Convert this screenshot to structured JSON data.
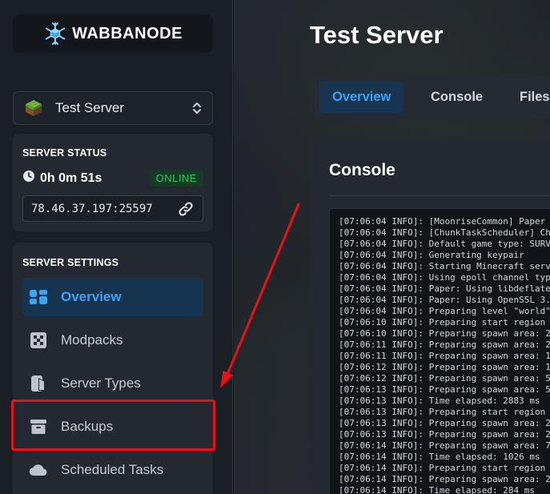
{
  "brand": {
    "name": "WABBANODE",
    "icon": "snowflake-cube-icon"
  },
  "server_select": {
    "label": "Test Server",
    "icon": "grass-block-icon",
    "chevron": "chevron-updown-icon"
  },
  "server_status": {
    "title": "SERVER STATUS",
    "uptime": "0h 0m 51s",
    "state": "ONLINE",
    "address": "78.46.37.197:25597"
  },
  "server_settings": {
    "title": "SERVER SETTINGS",
    "items": [
      {
        "label": "Overview",
        "icon": "overview-icon",
        "active": true
      },
      {
        "label": "Modpacks",
        "icon": "modpacks-icon",
        "active": false
      },
      {
        "label": "Server Types",
        "icon": "server-types-icon",
        "active": false
      },
      {
        "label": "Backups",
        "icon": "backups-icon",
        "active": false
      },
      {
        "label": "Scheduled Tasks",
        "icon": "cloud-icon",
        "active": false
      }
    ]
  },
  "main": {
    "title": "Test Server",
    "tabs": [
      {
        "label": "Overview",
        "active": true
      },
      {
        "label": "Console",
        "active": false
      },
      {
        "label": "Files",
        "active": false
      }
    ],
    "console_title": "Console",
    "console_lines": [
      "[07:06:04 INFO]: [MoonriseCommon] Paper",
      "[07:06:04 INFO]: [ChunkTaskScheduler] Ch",
      "[07:06:04 INFO]: Default game type: SURV",
      "[07:06:04 INFO]: Generating keypair",
      "[07:06:04 INFO]: Starting Minecraft serv",
      "[07:06:04 INFO]: Using epoll channel typ",
      "[07:06:04 INFO]: Paper: Using libdeflate",
      "[07:06:04 INFO]: Paper: Using OpenSSL 3.",
      "[07:06:04 INFO]: Preparing level \"world\"",
      "[07:06:10 INFO]: Preparing start region",
      "[07:06:10 INFO]: Preparing spawn area: 2",
      "[07:06:11 INFO]: Preparing spawn area: 2",
      "[07:06:11 INFO]: Preparing spawn area: 1",
      "[07:06:12 INFO]: Preparing spawn area: 1",
      "[07:06:12 INFO]: Preparing spawn area: 5",
      "[07:06:13 INFO]: Preparing spawn area: 5",
      "[07:06:13 INFO]: Time elapsed: 2883 ms",
      "[07:06:13 INFO]: Preparing start region",
      "[07:06:13 INFO]: Preparing spawn area: 2",
      "[07:06:13 INFO]: Preparing spawn area: 2",
      "[07:06:14 INFO]: Preparing spawn area: 7",
      "[07:06:14 INFO]: Time elapsed: 1026 ms",
      "[07:06:14 INFO]: Preparing start region",
      "[07:06:14 INFO]: Preparing spawn area: 2",
      "[07:06:14 INFO]: Time elapsed: 284 ms"
    ]
  },
  "annotation": {
    "highlight_color": "#e8101a"
  },
  "colors": {
    "accent": "#3ba3f5",
    "online": "#2fc46b"
  }
}
